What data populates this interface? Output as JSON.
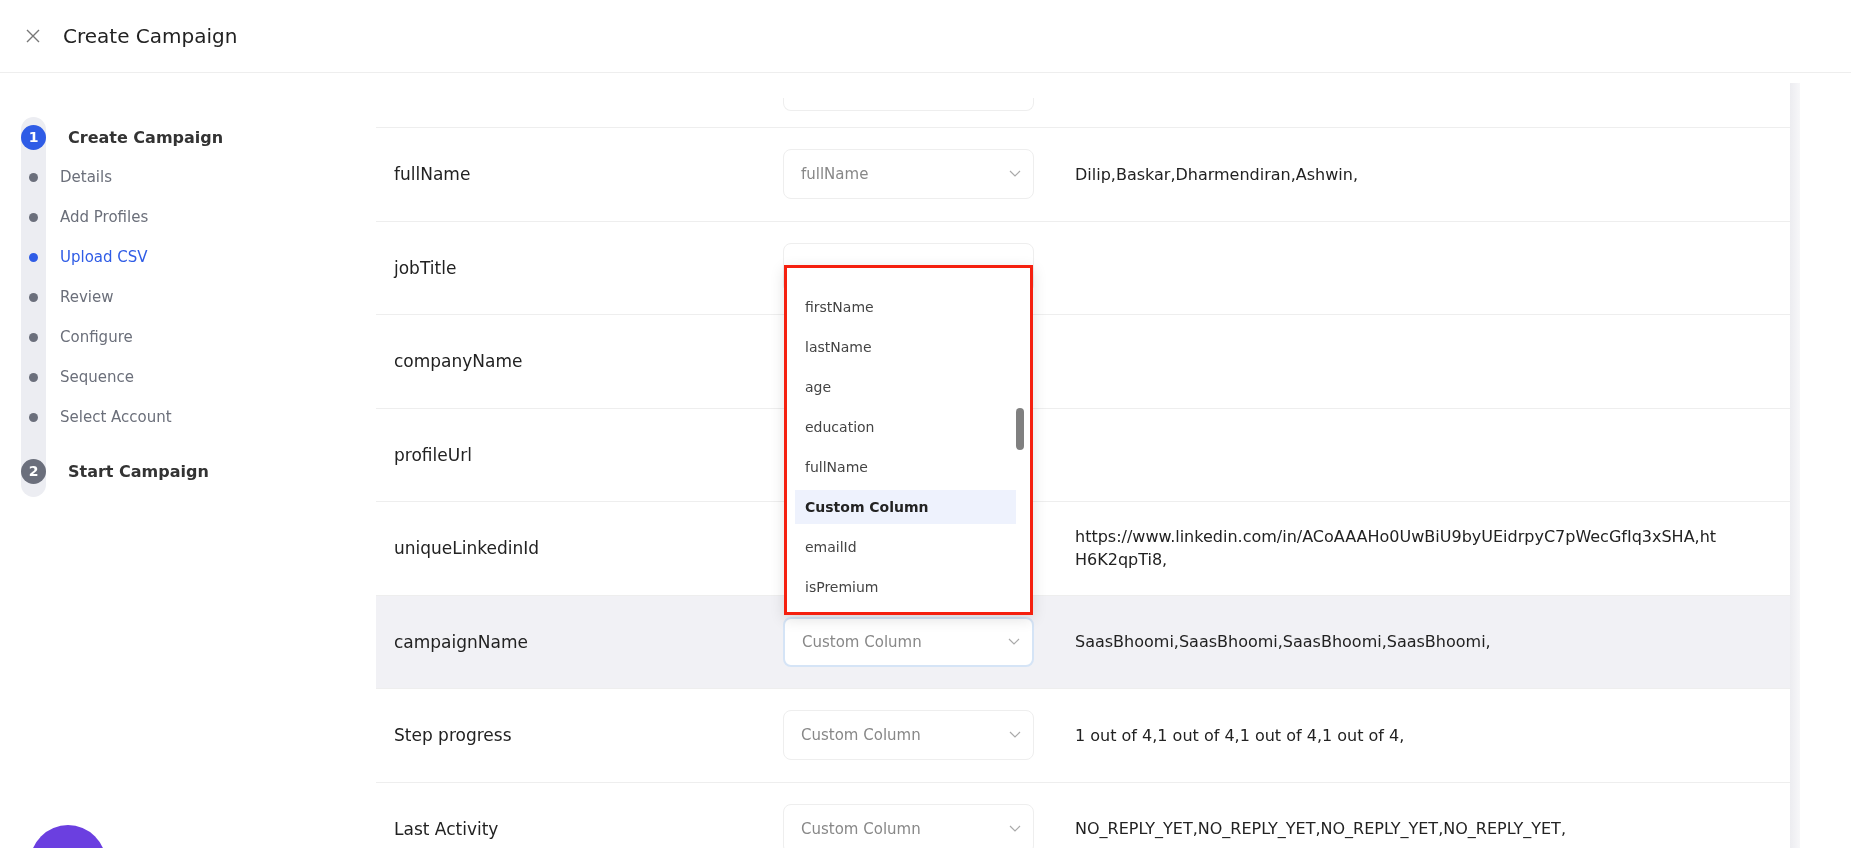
{
  "header": {
    "title": "Create Campaign"
  },
  "steps": [
    {
      "number": "1",
      "label": "Create Campaign",
      "active": true,
      "children": [
        {
          "label": "Details",
          "selected": false
        },
        {
          "label": "Add Profiles",
          "selected": false
        },
        {
          "label": "Upload CSV",
          "selected": true
        },
        {
          "label": "Review",
          "selected": false
        },
        {
          "label": "Configure",
          "selected": false
        },
        {
          "label": "Sequence",
          "selected": false
        },
        {
          "label": "Select Account",
          "selected": false
        }
      ]
    },
    {
      "number": "2",
      "label": "Start Campaign",
      "active": false
    }
  ],
  "rows": [
    {
      "field": "fullName",
      "select": {
        "value": "fullName",
        "focused": false
      },
      "value_lines": [
        "Dilip,Baskar,Dharmendiran,Ashwin,"
      ],
      "highlighted": false
    },
    {
      "field": "jobTitle",
      "select": {
        "focused": false,
        "open": true
      },
      "value_lines": [],
      "highlighted": false
    },
    {
      "field": "companyName",
      "value_lines": [],
      "highlighted": false
    },
    {
      "field": "profileUrl",
      "value_lines": [],
      "highlighted": false
    },
    {
      "field": "uniqueLinkedinId",
      "value_lines": [
        "https://www.linkedin.com/in/ACoAAAHo0UwBiU9byUEidrpyC7pWecGfIq3xSHA,ht",
        "H6K2qpTi8,"
      ],
      "highlighted": false
    },
    {
      "field": "campaignName",
      "select": {
        "value": "Custom Column",
        "focused": true
      },
      "value_lines": [
        "SaasBhoomi,SaasBhoomi,SaasBhoomi,SaasBhoomi,"
      ],
      "highlighted": true
    },
    {
      "field": "Step progress",
      "select": {
        "value": "Custom Column",
        "focused": false
      },
      "value_lines": [
        "1 out of 4,1 out of 4,1 out of 4,1 out of 4,"
      ],
      "highlighted": false
    },
    {
      "field": "Last Activity",
      "select": {
        "value": "Custom Column",
        "focused": false
      },
      "value_lines": [
        "NO_REPLY_YET,NO_REPLY_YET,NO_REPLY_YET,NO_REPLY_YET,"
      ],
      "highlighted": false
    }
  ],
  "dropdown": {
    "options": [
      {
        "label": "firstName",
        "selected": false
      },
      {
        "label": "lastName",
        "selected": false
      },
      {
        "label": "age",
        "selected": false
      },
      {
        "label": "education",
        "selected": false
      },
      {
        "label": "fullName",
        "selected": false
      },
      {
        "label": "Custom Column",
        "selected": true
      },
      {
        "label": "emailId",
        "selected": false
      },
      {
        "label": "isPremium",
        "selected": false
      }
    ]
  }
}
